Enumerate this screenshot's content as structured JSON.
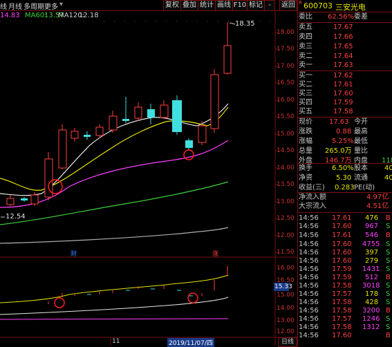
{
  "toolbar": {
    "items": [
      "线",
      "月线",
      "多周期",
      "更多"
    ],
    "buttons": [
      "复权",
      "叠加",
      "统计",
      "画线",
      "F10",
      "标记",
      "-",
      "返回"
    ]
  },
  "ma_legend": {
    "ma20": "14.83",
    "ma60_label": "MA60:",
    "ma60": "13.57",
    "ma120_label": "MA120:",
    "ma120": "12.18"
  },
  "main_axis": [
    "18.00",
    "17.50",
    "17.00",
    "16.50",
    "16.00",
    "15.50",
    "15.00",
    "14.50",
    "14.00",
    "13.50",
    "13.00",
    "12.50",
    "12.00",
    "11.50"
  ],
  "sub_axis": [
    "16.00",
    "16.50",
    "15.00",
    "14.00",
    "13.00",
    "12.00"
  ],
  "sub_axis_current": "15.33",
  "annotations": {
    "high_price": "18.35",
    "low_price": "12.54",
    "marker_cai": "财",
    "marker_zhang": "涨",
    "bottom_tick": "11",
    "date_label": "2019/11/07/四"
  },
  "stock": {
    "code": "600703",
    "name": "三安光电",
    "tag": "R"
  },
  "order_book": {
    "weibi_label": "委比",
    "weibi": "62.56%",
    "weicha_label": "委差",
    "weicha": "",
    "asks": [
      {
        "label": "卖五",
        "price": "17.67"
      },
      {
        "label": "卖四",
        "price": "17.66"
      },
      {
        "label": "卖三",
        "price": "17.65"
      },
      {
        "label": "卖二",
        "price": "17.64"
      },
      {
        "label": "卖一",
        "price": "17.63"
      }
    ],
    "bids": [
      {
        "label": "买一",
        "price": "17.62"
      },
      {
        "label": "买二",
        "price": "17.61"
      },
      {
        "label": "买三",
        "price": "17.60"
      },
      {
        "label": "买四",
        "price": "17.59"
      },
      {
        "label": "买五",
        "price": "17.58"
      }
    ]
  },
  "quote": {
    "rows": [
      {
        "l1": "现价",
        "v1": "17.63",
        "l2": "今开",
        "v2": ""
      },
      {
        "l1": "涨跌",
        "v1": "0.88",
        "l2": "最高",
        "v2": ""
      },
      {
        "l1": "涨幅",
        "v1": "5.25%",
        "l2": "最低",
        "v2": ""
      },
      {
        "l1": "总量",
        "v1": "265.0万",
        "l2": "量比",
        "v2": ""
      },
      {
        "l1": "外盘",
        "v1": "146.7万",
        "l2": "内盘",
        "v2": "118"
      }
    ],
    "rows2": [
      {
        "l1": "换手",
        "v1": "6.50%",
        "l2": "股本",
        "v2": "40"
      },
      {
        "l1": "净资",
        "v1": "5.30",
        "l2": "流通",
        "v2": "40"
      },
      {
        "l1": "收益(三)",
        "v1": "0.283",
        "l2": "PE(动)",
        "v2": ""
      }
    ]
  },
  "flow": {
    "net_inflow_label": "净流入额",
    "net_inflow": "4.97亿",
    "block_inflow_label": "大宗流入",
    "block_inflow": "4.51亿"
  },
  "ticks": [
    {
      "time": "14:56",
      "price": "17.61",
      "vol": "476",
      "dir": "B"
    },
    {
      "time": "14:56",
      "price": "17.60",
      "vol": "967",
      "dir": "S"
    },
    {
      "time": "14:56",
      "price": "17.61",
      "vol": "546",
      "dir": "B"
    },
    {
      "time": "14:56",
      "price": "17.60",
      "vol": "4755",
      "dir": "S"
    },
    {
      "time": "14:56",
      "price": "17.60",
      "vol": "397",
      "dir": "S"
    },
    {
      "time": "14:56",
      "price": "17.60",
      "vol": "279",
      "dir": "S"
    },
    {
      "time": "14:56",
      "price": "17.59",
      "vol": "1431",
      "dir": "S"
    },
    {
      "time": "14:56",
      "price": "17.59",
      "vol": "512",
      "dir": "B"
    },
    {
      "time": "14:56",
      "price": "17.58",
      "vol": "3018",
      "dir": "S"
    },
    {
      "time": "14:56",
      "price": "17.57",
      "vol": "178",
      "dir": "S"
    },
    {
      "time": "14:56",
      "price": "17.58",
      "vol": "428",
      "dir": "S"
    },
    {
      "time": "14:56",
      "price": "17.58",
      "vol": "3200",
      "dir": "B"
    },
    {
      "time": "14:56",
      "price": "17.57",
      "vol": "1246",
      "dir": "S"
    },
    {
      "time": "14:56",
      "price": "17.58",
      "vol": "1312",
      "dir": "S"
    },
    {
      "time": "14:56",
      "price": "17.60",
      "vol": "",
      "dir": "B"
    }
  ],
  "bottom_button": "日线",
  "colors": {
    "up": "#ff4040",
    "down": "#40e0e0",
    "ma5": "#e8e8e8",
    "ma10": "#e6e600",
    "ma20": "#ff40ff",
    "ma60": "#3cd23c",
    "ma120": "#b0b0b0"
  }
}
